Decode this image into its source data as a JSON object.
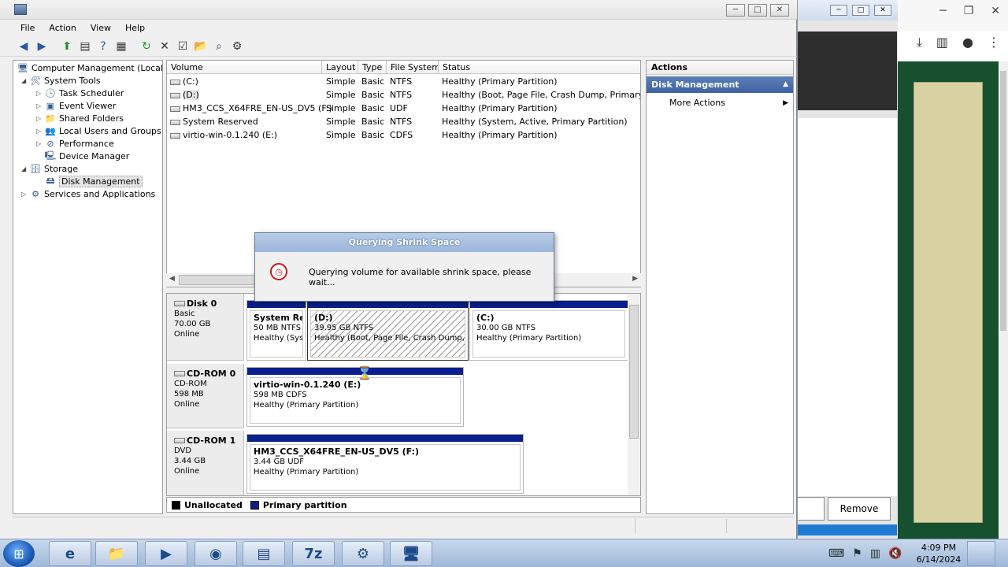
{
  "menu": [
    "File",
    "Action",
    "View",
    "Help"
  ],
  "toolbar_icons": [
    "back-icon",
    "forward-icon",
    "up-icon",
    "show-hide-tree-icon",
    "help-icon",
    "show-hide-action-icon",
    "refresh-icon",
    "delete-icon",
    "properties-icon",
    "open-icon",
    "search-icon",
    "settings-icon"
  ],
  "tree": {
    "root": "Computer Management (Local)",
    "system_tools": "System Tools",
    "task_scheduler": "Task Scheduler",
    "event_viewer": "Event Viewer",
    "shared_folders": "Shared Folders",
    "local_users": "Local Users and Groups",
    "performance": "Performance",
    "device_manager": "Device Manager",
    "storage": "Storage",
    "disk_management": "Disk Management",
    "services": "Services and Applications"
  },
  "volumes": {
    "headers": [
      "Volume",
      "Layout",
      "Type",
      "File System",
      "Status"
    ],
    "rows": [
      [
        "(C:)",
        "Simple",
        "Basic",
        "NTFS",
        "Healthy (Primary Partition)"
      ],
      [
        "(D:)",
        "Simple",
        "Basic",
        "NTFS",
        "Healthy (Boot, Page File, Crash Dump, Primary Partit"
      ],
      [
        "HM3_CCS_X64FRE_EN-US_DV5 (F:)",
        "Simple",
        "Basic",
        "UDF",
        "Healthy (Primary Partition)"
      ],
      [
        "System Reserved",
        "Simple",
        "Basic",
        "NTFS",
        "Healthy (System, Active, Primary Partition)"
      ],
      [
        "virtio-win-0.1.240 (E:)",
        "Simple",
        "Basic",
        "CDFS",
        "Healthy (Primary Partition)"
      ]
    ]
  },
  "disks": {
    "disk0": {
      "name": "Disk 0",
      "type": "Basic",
      "size": "70.00 GB",
      "state": "Online",
      "p1": {
        "name": "System Re",
        "size": "50 MB NTFS",
        "status": "Healthy (Sys"
      },
      "p2": {
        "name": "(D:)",
        "size": "39.95 GB NTFS",
        "status": "Healthy (Boot, Page File, Crash Dump, P"
      },
      "p3": {
        "name": "(C:)",
        "size": "30.00 GB NTFS",
        "status": "Healthy (Primary Partition)"
      }
    },
    "cdrom0": {
      "name": "CD-ROM 0",
      "type": "CD-ROM",
      "size": "598 MB",
      "state": "Online",
      "p1": {
        "name": "virtio-win-0.1.240  (E:)",
        "size": "598 MB CDFS",
        "status": "Healthy (Primary Partition)"
      }
    },
    "cdrom1": {
      "name": "CD-ROM 1",
      "type": "DVD",
      "size": "3.44 GB",
      "state": "Online",
      "p1": {
        "name": "HM3_CCS_X64FRE_EN-US_DV5  (F:)",
        "size": "3.44 GB UDF",
        "status": "Healthy (Primary Partition)"
      }
    }
  },
  "legend": {
    "unallocated": "Unallocated",
    "primary": "Primary partition",
    "unallocated_color": "#000000",
    "primary_color": "#0a1e8c"
  },
  "actions": {
    "header": "Actions",
    "section": "Disk Management",
    "more": "More Actions"
  },
  "dialog": {
    "title": "Querying Shrink Space",
    "message": "Querying volume for available shrink space, please wait..."
  },
  "second_window": {
    "remove_label": "Remove"
  },
  "taskbar": {
    "time": "4:09 PM",
    "date": "6/14/2024",
    "sevenzip_label": "7z"
  }
}
